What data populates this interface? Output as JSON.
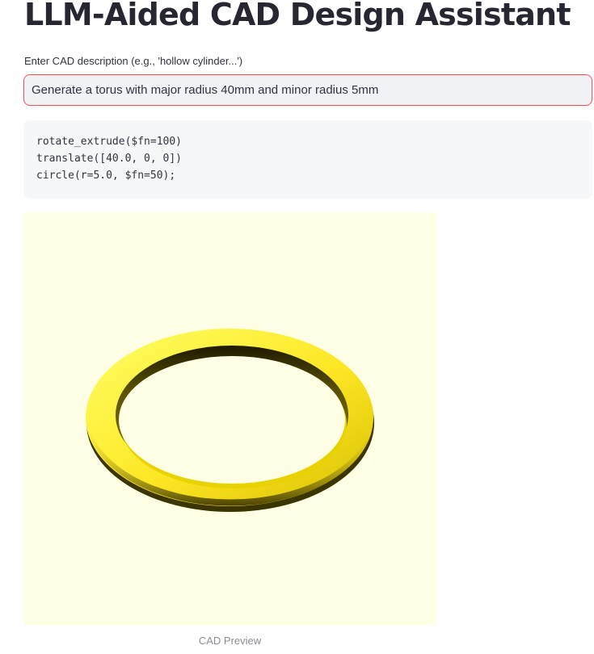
{
  "app": {
    "title": "LLM-Aided CAD Design Assistant"
  },
  "input": {
    "label": "Enter CAD description (e.g., 'hollow cylinder...')",
    "value": "Generate a torus with major radius 40mm and minor radius 5mm"
  },
  "code": {
    "lines": [
      "rotate_extrude($fn=100)",
      "translate([40.0, 0, 0])",
      "circle(r=5.0, $fn=50);"
    ]
  },
  "preview": {
    "caption": "CAD Preview",
    "background_color": "#ffffe5",
    "model_color": "#fde724"
  },
  "colors": {
    "input_border": "#ff4b4b",
    "input_background": "#f0f2f6",
    "code_background": "#f6f7f9"
  }
}
